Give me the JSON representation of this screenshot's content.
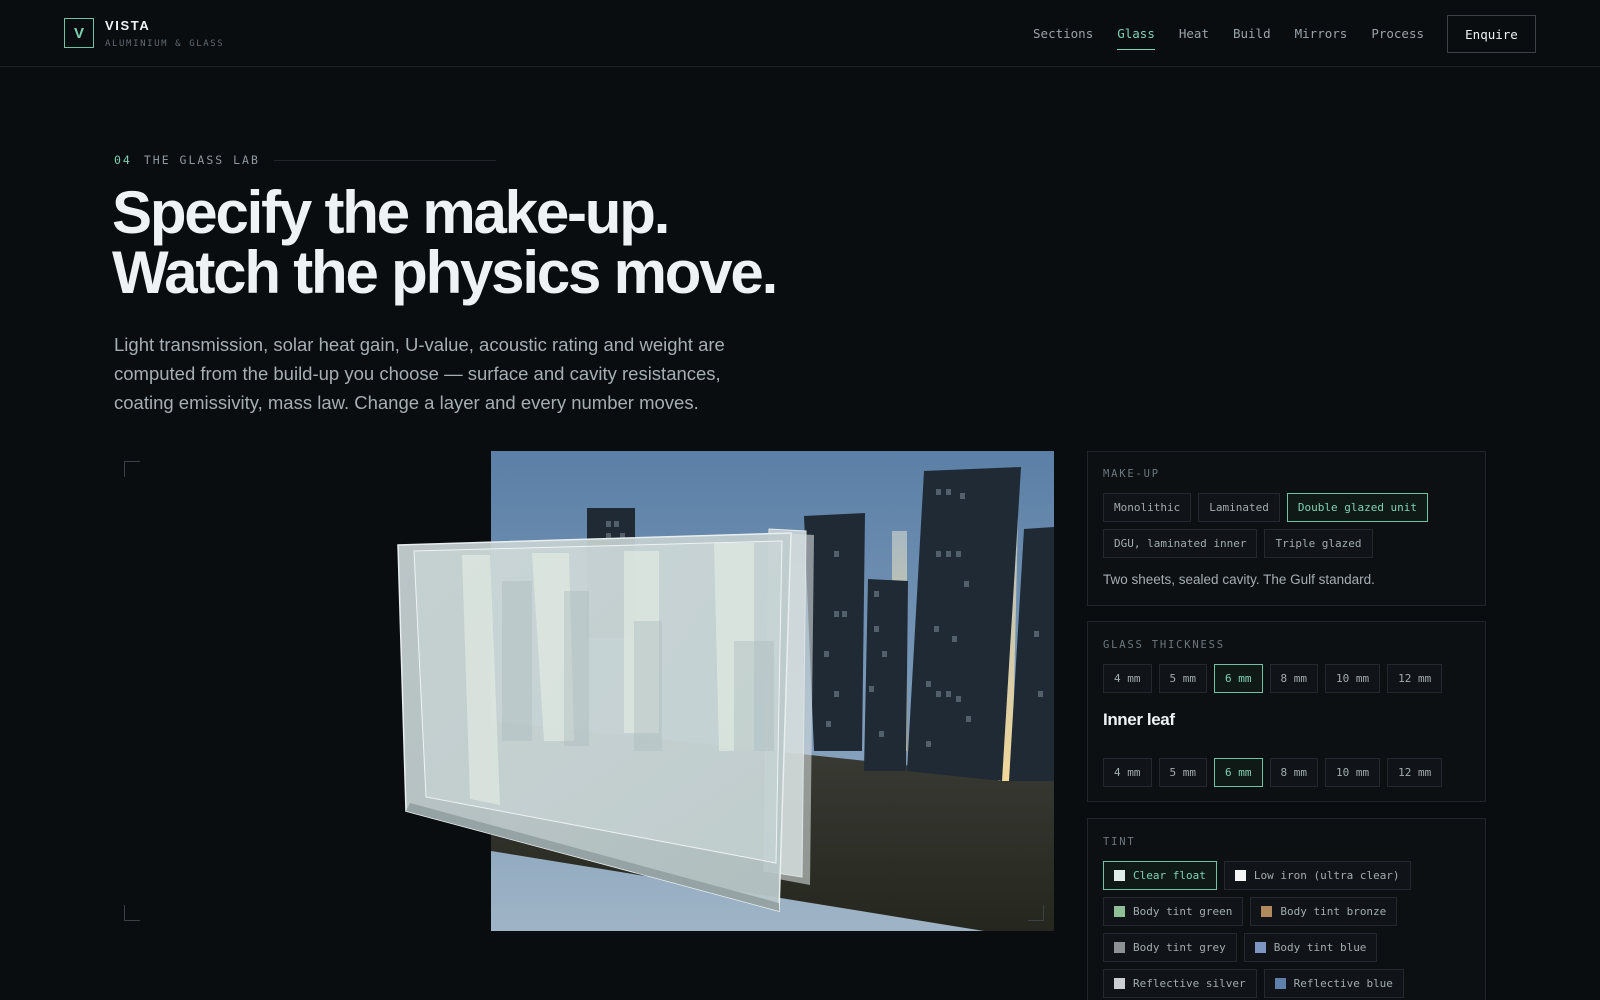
{
  "nav": {
    "logo_letter": "V",
    "brand": "VISTA",
    "brand_sub": "ALUMINIUM & GLASS",
    "links": [
      "Sections",
      "Glass",
      "Heat",
      "Build",
      "Mirrors",
      "Process"
    ],
    "active_link": "Glass",
    "cta": "Enquire"
  },
  "hero": {
    "eyebrow_num": "04",
    "eyebrow_text": "THE GLASS LAB",
    "headline_1": "Specify the make-up.",
    "headline_2": "Watch the physics move.",
    "lede": "Light transmission, solar heat gain, U-value, acoustic rating and weight are computed from the build-up you choose — surface and cavity resistances, coating emissivity, mass law. Change a layer and every number moves."
  },
  "makeup": {
    "label": "MAKE-UP",
    "options": [
      "Monolithic",
      "Laminated",
      "Double glazed unit",
      "DGU, laminated inner",
      "Triple glazed"
    ],
    "selected": "Double glazed unit",
    "description": "Two sheets, sealed cavity. The Gulf standard."
  },
  "thickness": {
    "label": "GLASS THICKNESS",
    "options": [
      "4 mm",
      "5 mm",
      "6 mm",
      "8 mm",
      "10 mm",
      "12 mm"
    ],
    "selected_outer": "6 mm",
    "inner_label": "Inner leaf",
    "selected_inner": "6 mm"
  },
  "tint": {
    "label": "TINT",
    "options": [
      {
        "name": "Clear float",
        "color": "#dfeee8"
      },
      {
        "name": "Low iron (ultra clear)",
        "color": "#f4f6f6"
      },
      {
        "name": "Body tint green",
        "color": "#8fbf97"
      },
      {
        "name": "Body tint bronze",
        "color": "#b08a5c"
      },
      {
        "name": "Body tint grey",
        "color": "#8c9194"
      },
      {
        "name": "Body tint blue",
        "color": "#7d95c2"
      },
      {
        "name": "Reflective silver",
        "color": "#c9cfd3"
      },
      {
        "name": "Reflective blue",
        "color": "#5f80a8"
      }
    ],
    "selected": "Clear float"
  },
  "colors": {
    "accent": "#7fd1b3",
    "background": "#0a0d10",
    "panel_border": "#20272c"
  }
}
